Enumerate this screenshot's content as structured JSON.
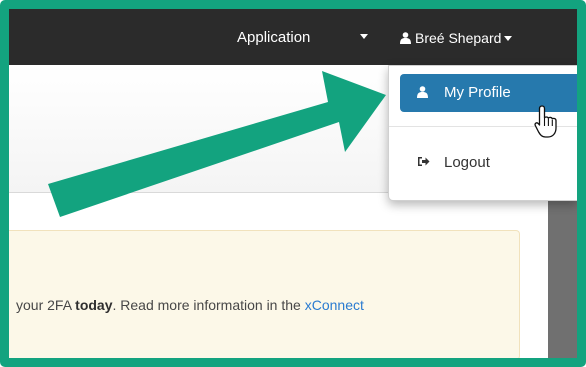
{
  "navbar": {
    "application_label": "Application",
    "user_name": "Breé Shepard"
  },
  "user_menu": {
    "profile_label": "My Profile",
    "logout_label": "Logout"
  },
  "alert": {
    "text_before": "your 2FA ",
    "text_bold": "today",
    "text_after": ". Read more information in the ",
    "link_text": "xConnect"
  },
  "colors": {
    "frame": "#13a37f",
    "navbar": "#2b2b2b",
    "menu_active": "#2679ad",
    "alert_bg": "#fcf8e8",
    "link": "#2a7bd0",
    "annotation_arrow": "#13a37f"
  },
  "icons": {
    "user": "user-icon",
    "logout": "sign-out-icon",
    "cursor": "hand-pointer-icon"
  }
}
